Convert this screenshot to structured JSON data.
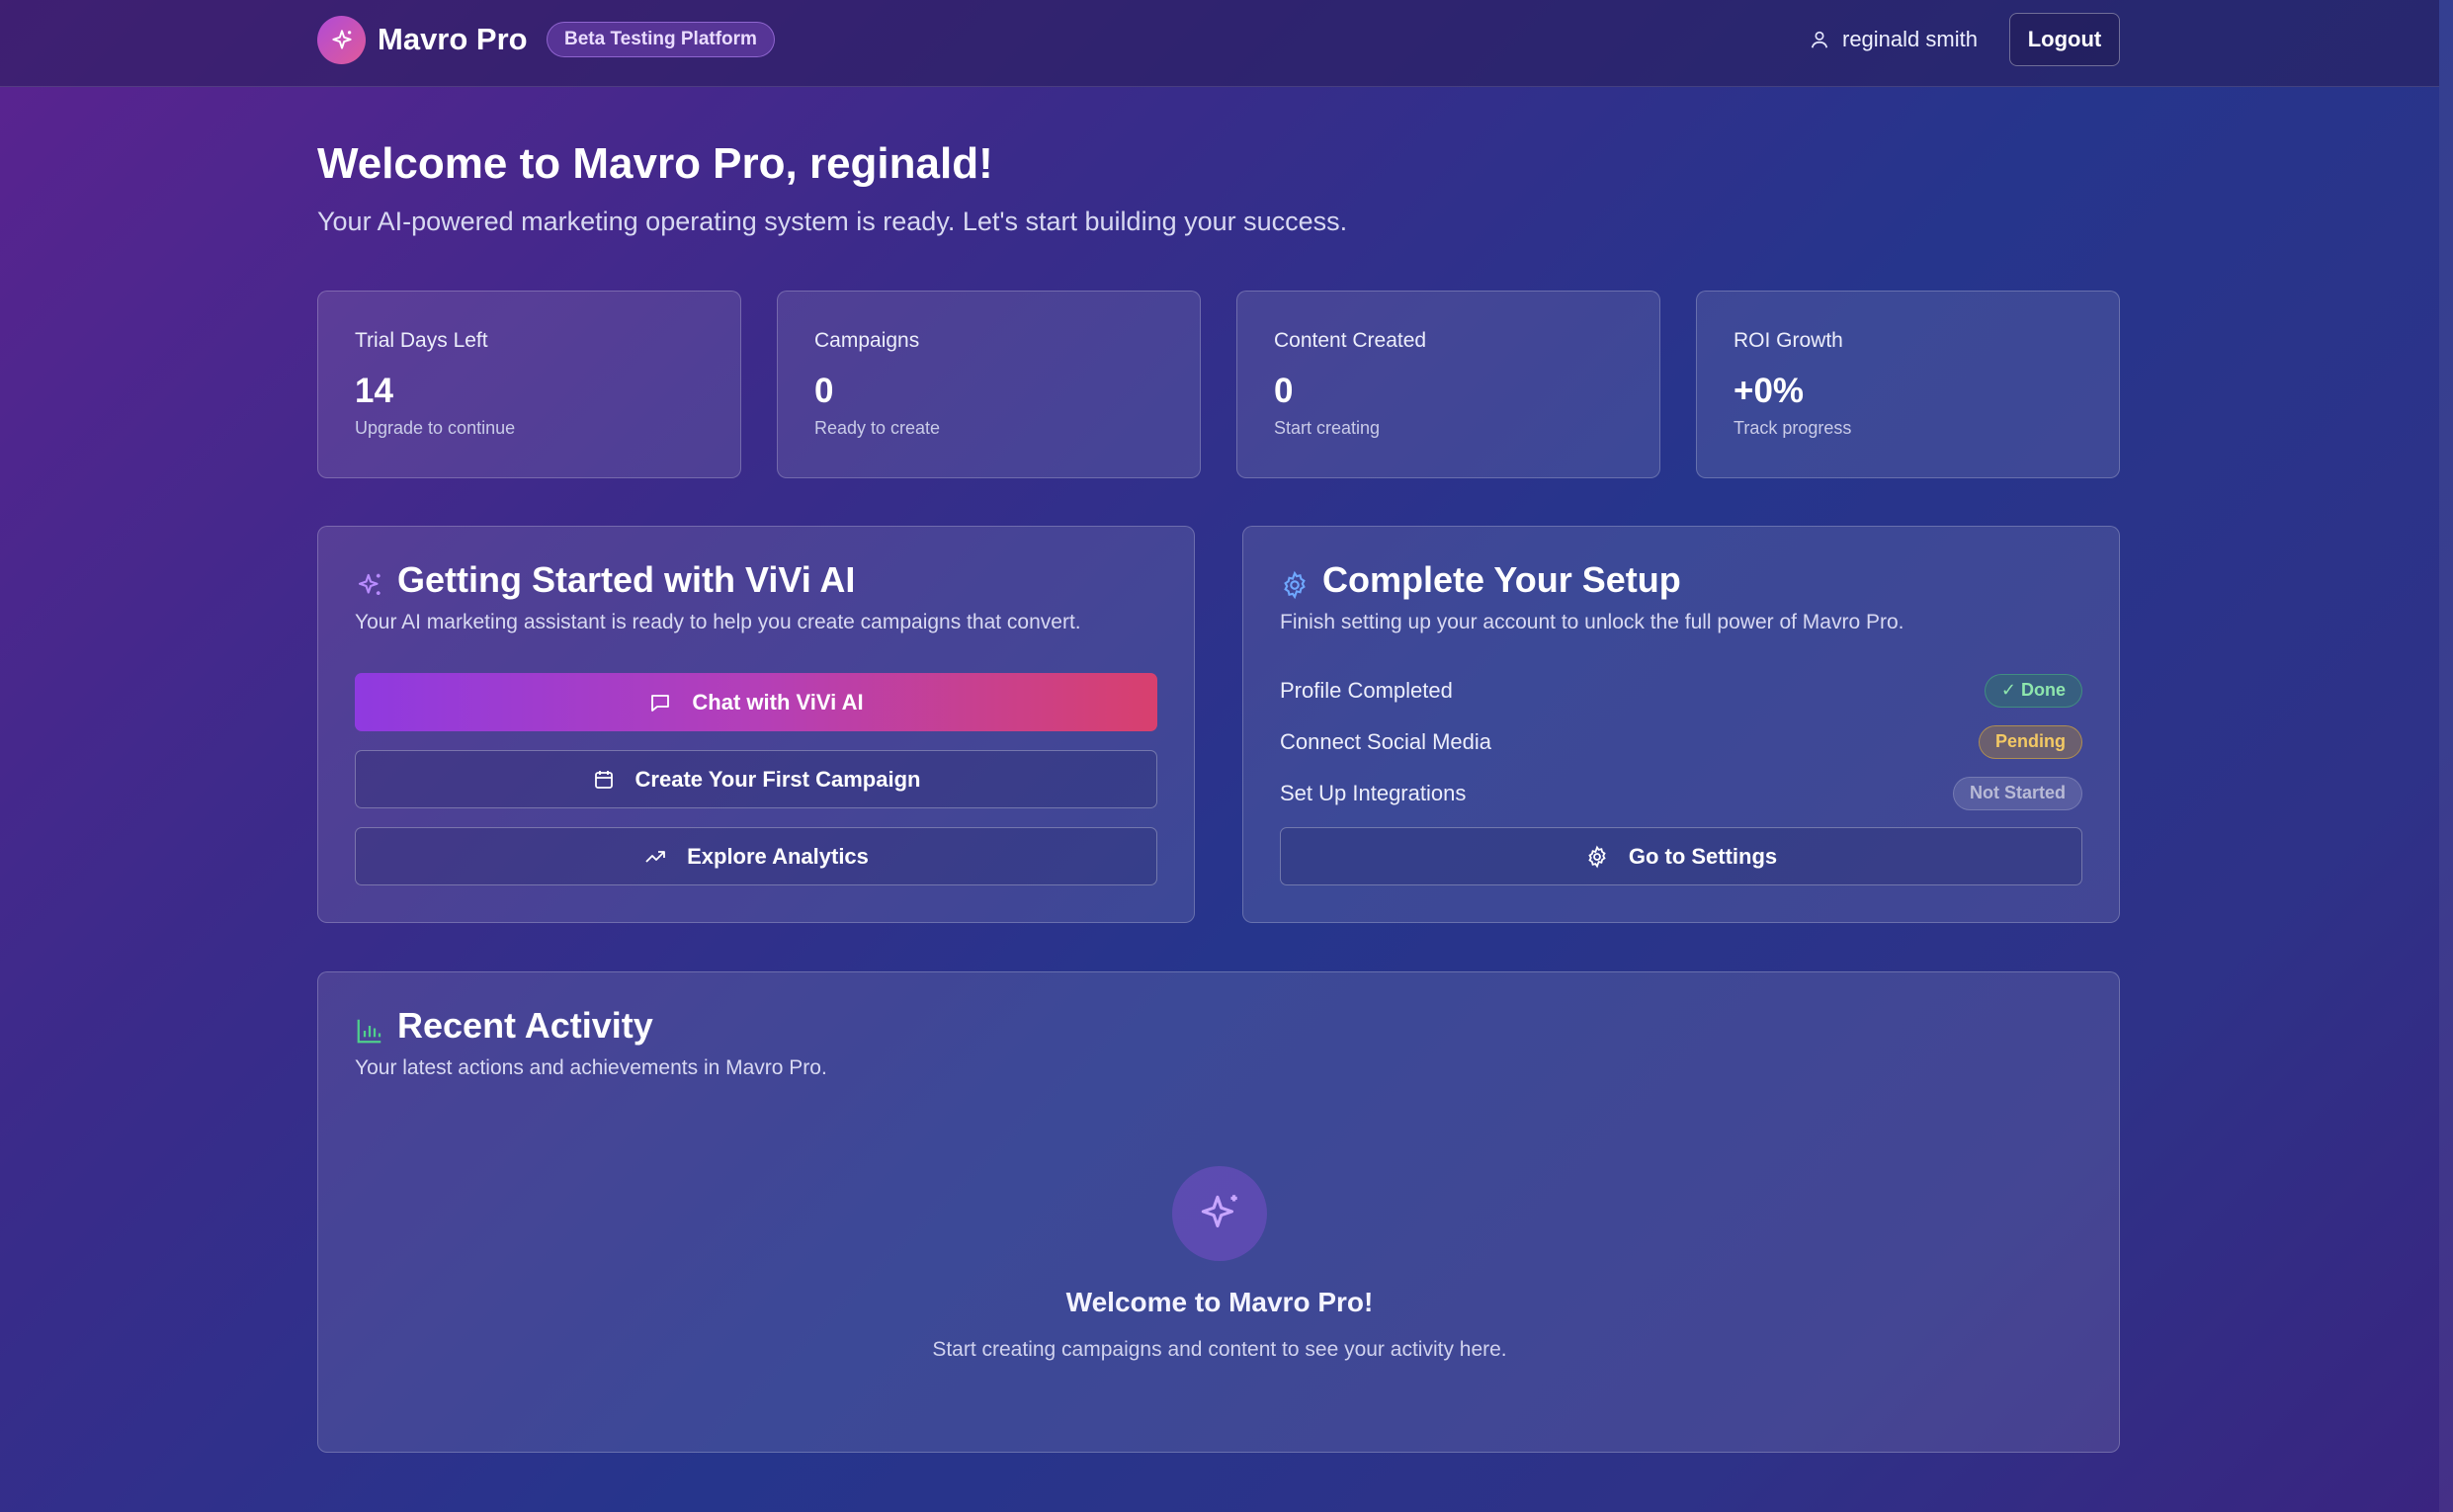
{
  "header": {
    "brand": "Mavro Pro",
    "badge": "Beta Testing Platform",
    "user_name": "reginald smith",
    "logout_label": "Logout"
  },
  "welcome": {
    "title": "Welcome to Mavro Pro, reginald!",
    "subtitle": "Your AI-powered marketing operating system is ready. Let's start building your success."
  },
  "stats": [
    {
      "label": "Trial Days Left",
      "value": "14",
      "sub": "Upgrade to continue"
    },
    {
      "label": "Campaigns",
      "value": "0",
      "sub": "Ready to create"
    },
    {
      "label": "Content Created",
      "value": "0",
      "sub": "Start creating"
    },
    {
      "label": "ROI Growth",
      "value": "+0%",
      "sub": "Track progress"
    }
  ],
  "getting_started": {
    "title": "Getting Started with ViVi AI",
    "subtitle": "Your AI marketing assistant is ready to help you create campaigns that convert.",
    "chat_label": "Chat with ViVi AI",
    "campaign_label": "Create Your First Campaign",
    "analytics_label": "Explore Analytics"
  },
  "setup": {
    "title": "Complete Your Setup",
    "subtitle": "Finish setting up your account to unlock the full power of Mavro Pro.",
    "items": [
      {
        "label": "Profile Completed",
        "status": "✓ Done"
      },
      {
        "label": "Connect Social Media",
        "status": "Pending"
      },
      {
        "label": "Set Up Integrations",
        "status": "Not Started"
      }
    ],
    "settings_label": "Go to Settings"
  },
  "activity": {
    "title": "Recent Activity",
    "subtitle": "Your latest actions and achievements in Mavro Pro.",
    "empty_title": "Welcome to Mavro Pro!",
    "empty_sub": "Start creating campaigns and content to see your activity here."
  },
  "colors": {
    "accent_purple": "#8f3ae0",
    "accent_pink": "#d8406e",
    "done_green": "#8ee6ad",
    "pending_amber": "#f3c964"
  }
}
